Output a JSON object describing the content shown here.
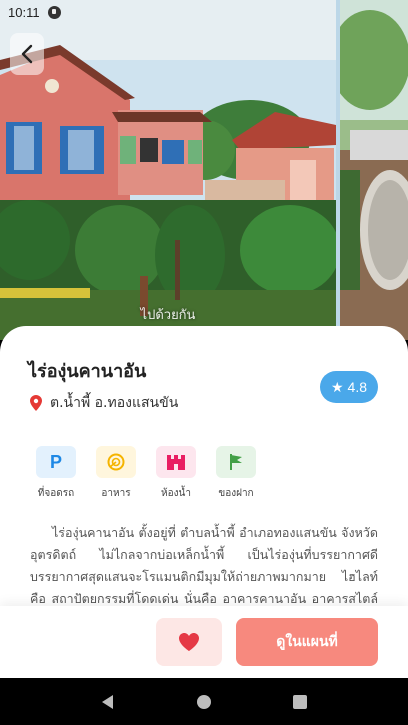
{
  "status_bar": {
    "time": "10:11"
  },
  "hero": {
    "photo_credit": "ไปด้วยกัน"
  },
  "place": {
    "title": "ไร่องุ่นคานาอัน",
    "location": "ต.น้ำพี้ อ.ทองแสนขัน",
    "rating": "4.8"
  },
  "amenities": [
    {
      "label": "ที่จอดรถ",
      "icon": "parking-icon",
      "color": "#1e88e5",
      "bg": "#e3f1fd"
    },
    {
      "label": "อาหาร",
      "icon": "food-icon",
      "color": "#f5b400",
      "bg": "#fff6dd"
    },
    {
      "label": "ห้องน้ำ",
      "icon": "restroom-icon",
      "color": "#e91e63",
      "bg": "#fde6ee"
    },
    {
      "label": "ของฝาก",
      "icon": "souvenir-flag-icon",
      "color": "#43a047",
      "bg": "#e6f4e7"
    }
  ],
  "description": "ไร่องุ่นคานาอัน ตั้งอยู่ที่ ตำบลน้ำพี้ อำเภอทองแสนขัน จังหวัดอุตรดิตถ์ ไม่ไกลจากบ่อเหล็กน้ำพี้ เป็นไร่องุ่นที่บรรยากาศดี บรรยากาศสุดแสนจะโรแมนติกมีมุมให้ถ่ายภาพมากมาย ไฮไลท์ คือ สถาปัตยกรรมที่โดดเด่น นั่นคือ อาคารคานาอัน อาคารสไตล์ทัศคา",
  "actions": {
    "map_label": "ดูในแผนที่"
  },
  "colors": {
    "accent": "#f7897e",
    "rating_bg": "#4aa8ea",
    "fav_bg": "#fde7e5"
  }
}
